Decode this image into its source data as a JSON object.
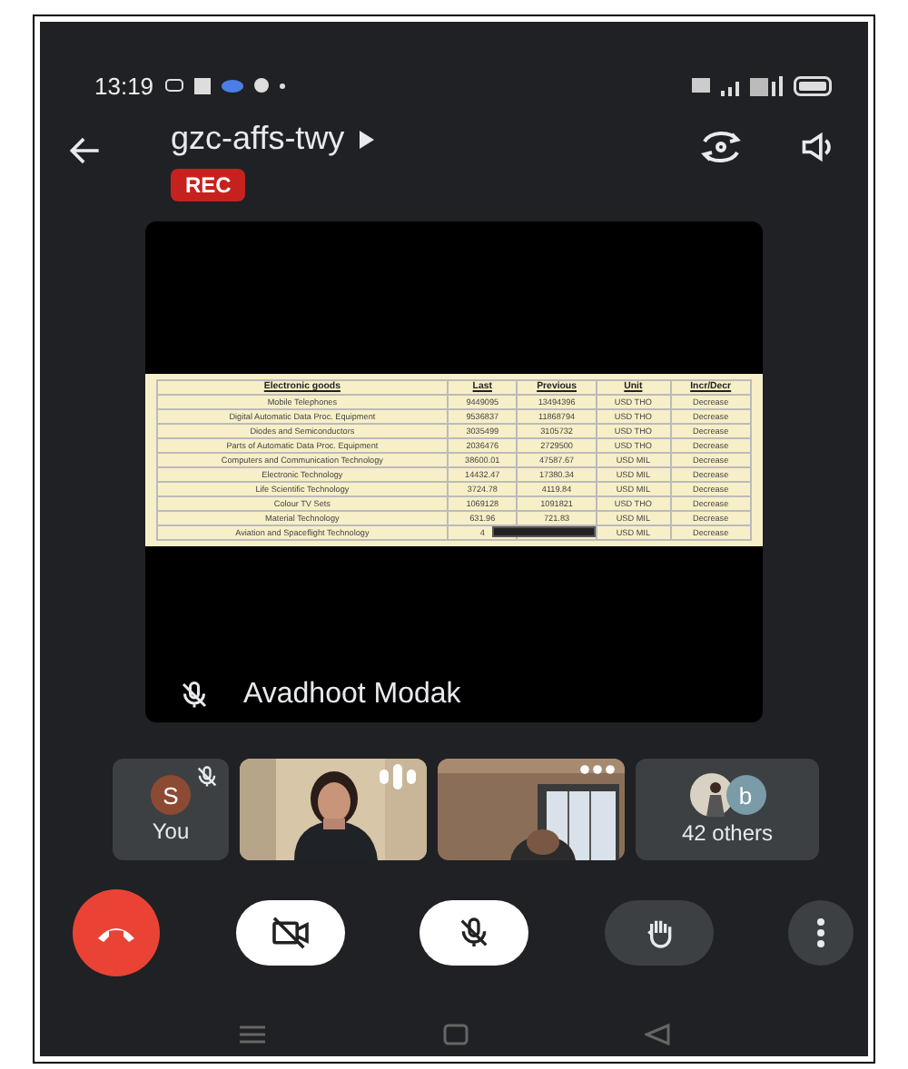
{
  "status_bar": {
    "time": "13:19"
  },
  "meeting": {
    "title": "gzc-affs-twy",
    "recording_label": "REC"
  },
  "presentation": {
    "presenter": "Avadhoot Modak",
    "presenter_muted": true,
    "table": {
      "columns": [
        "Electronic goods",
        "Last",
        "Previous",
        "Unit",
        "Incr/Decr"
      ],
      "rows": [
        [
          "Mobile Telephones",
          "9449095",
          "13494396",
          "USD THO",
          "Decrease"
        ],
        [
          "Digital Automatic Data Proc. Equipment",
          "9536837",
          "11868794",
          "USD THO",
          "Decrease"
        ],
        [
          "Diodes and Semiconductors",
          "3035499",
          "3105732",
          "USD THO",
          "Decrease"
        ],
        [
          "Parts of Automatic Data Proc. Equipment",
          "2036476",
          "2729500",
          "USD THO",
          "Decrease"
        ],
        [
          "Computers and Communication Technology",
          "38600.01",
          "47587.67",
          "USD MIL",
          "Decrease"
        ],
        [
          "Electronic Technology",
          "14432.47",
          "17380.34",
          "USD MIL",
          "Decrease"
        ],
        [
          "Life Scientific Technology",
          "3724.78",
          "4119.84",
          "USD MIL",
          "Decrease"
        ],
        [
          "Colour TV Sets",
          "1069128",
          "1091821",
          "USD THO",
          "Decrease"
        ],
        [
          "Material Technology",
          "631.96",
          "721.83",
          "USD MIL",
          "Decrease"
        ],
        [
          "Aviation and Spaceflight Technology",
          "4",
          "",
          "USD MIL",
          "Decrease"
        ]
      ]
    }
  },
  "tiles": [
    {
      "kind": "avatar",
      "initial": "S",
      "label": "You",
      "muted": true
    },
    {
      "kind": "video",
      "speaking": true
    },
    {
      "kind": "video",
      "speaking": false
    },
    {
      "kind": "others",
      "initial": "b",
      "label": "42 others"
    }
  ],
  "controls": {
    "camera_on": false,
    "mic_on": false
  }
}
